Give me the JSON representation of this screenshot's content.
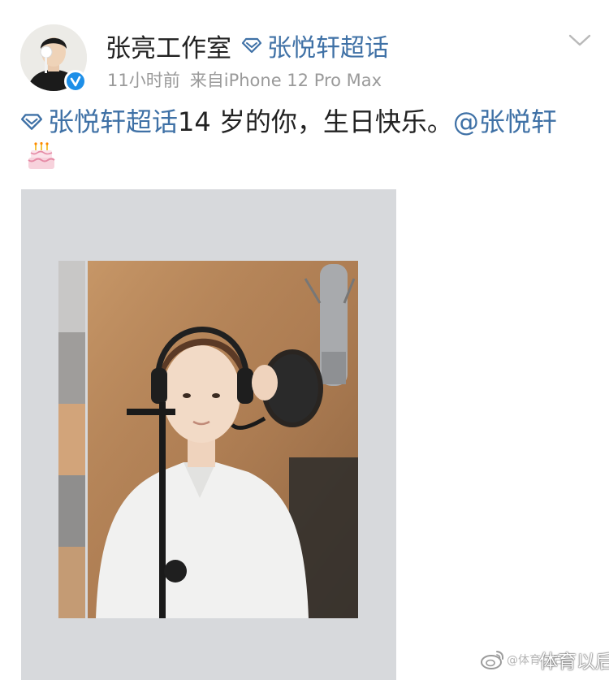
{
  "post": {
    "author": {
      "name": "张亮工作室",
      "verified": true
    },
    "topic": {
      "name": "张悦轩超话",
      "icon": "diamond-icon"
    },
    "time": "11小时前",
    "source": "来自iPhone 12 Pro Max",
    "content": {
      "topic": "张悦轩超话",
      "text": "14 岁的你，生日快乐。",
      "mention": "@张悦轩",
      "emoji": "cake-icon"
    },
    "image": {
      "description_icon": "photo"
    }
  },
  "watermark": {
    "logo": "weibo-logo-icon",
    "handle": "@体育以后",
    "text": "体育以后"
  },
  "colors": {
    "link": "#3f71a6",
    "meta": "#9a9a9a",
    "verified": "#1e8fe8",
    "text": "#222222"
  }
}
